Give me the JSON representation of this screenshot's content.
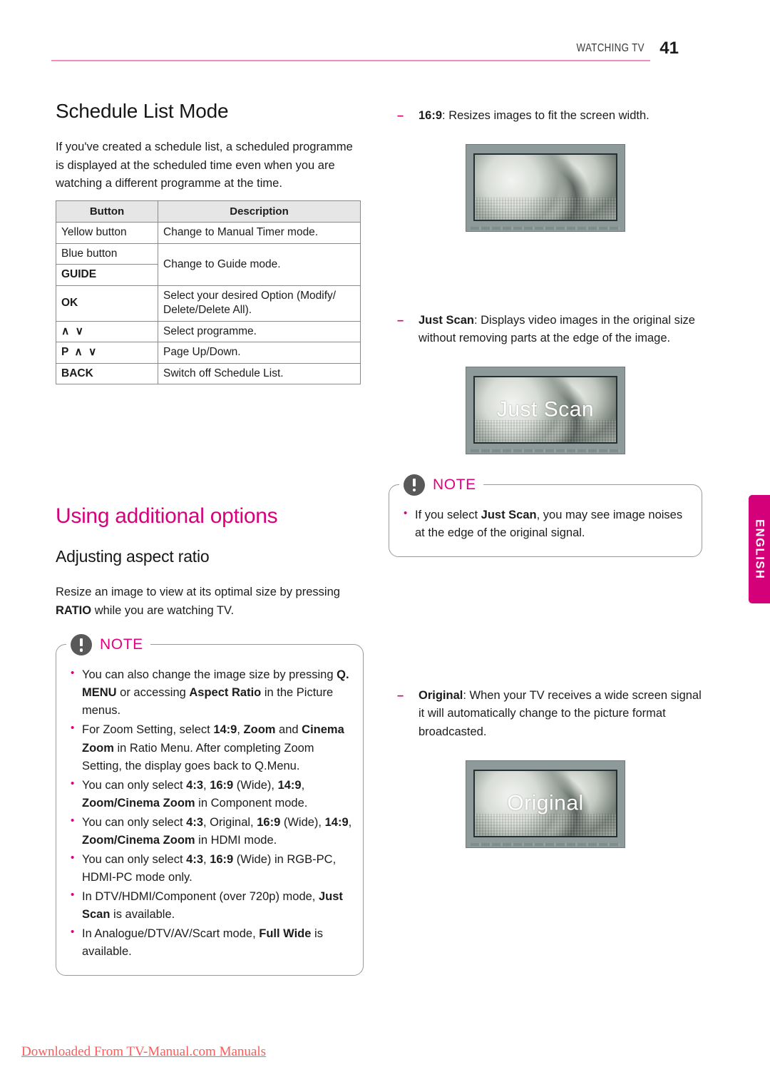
{
  "header": {
    "section_label": "WATCHING TV",
    "page_number": "41",
    "rule_color": "#f08cbe"
  },
  "left_column": {
    "title": "Schedule List Mode",
    "intro": "If you've created a schedule list, a scheduled programme is displayed at the scheduled time even when you are watching a different programme at the time.",
    "table": {
      "headers": [
        "Button",
        "Description"
      ],
      "rows": [
        {
          "button": "Yellow button",
          "bold": false,
          "description": "Change to Manual Timer mode."
        },
        {
          "button": "Blue button",
          "bold": false,
          "description": "Change to Guide mode.",
          "merged_start": true
        },
        {
          "button": "GUIDE",
          "bold": true,
          "description": ""
        },
        {
          "button": "OK",
          "bold": true,
          "description": "Select your desired Option (Modify/ Delete/Delete All)."
        },
        {
          "button": "∧ ∨",
          "bold": true,
          "description": "Select programme."
        },
        {
          "button": "P ∧ ∨",
          "bold": true,
          "description": "Page Up/Down."
        },
        {
          "button": "BACK",
          "bold": true,
          "description": "Switch off Schedule List."
        }
      ]
    },
    "section_title": "Using additional options",
    "sub_title": "Adjusting aspect ratio",
    "sub_intro_part1": "Resize an image to view at its optimal size by pressing ",
    "sub_intro_bold": "RATIO",
    "sub_intro_part2": " while you are watching TV.",
    "note": {
      "label": "NOTE",
      "icon": "exclamation-circle-icon",
      "items": [
        "You can also change the image size by pressing <b>Q. MENU</b> or accessing <b>Aspect Ratio</b> in the Picture menus.",
        "For Zoom Setting, select <b>14:9</b>, <b>Zoom</b> and <b>Cinema Zoom</b> in Ratio Menu. After completing Zoom Setting, the display goes back to Q.Menu.",
        "You can only select <b>4:3</b>, <b>16:9</b> (Wide), <b>14:9</b>, <b>Zoom/Cinema Zoom</b> in Component mode.",
        "You can only select <b>4:3</b>, Original, <b>16:9</b> (Wide), <b>14:9</b>, <b>Zoom/Cinema Zoom</b> in HDMI mode.",
        "You can only select <b>4:3</b>, <b>16:9</b> (Wide) in RGB-PC, HDMI-PC mode only.",
        "In DTV/HDMI/Component (over 720p) mode, <b>Just Scan</b> is available.",
        "In Analogue/DTV/AV/Scart mode, <b>Full Wide</b> is available."
      ]
    }
  },
  "right_column": {
    "item_169": "<b>16:9</b>: Resizes images to fit the screen width.",
    "tv_169_caption": "",
    "item_just_scan": "<b>Just Scan</b>: Displays video images in the original size without removing parts at the edge of the image.",
    "tv_just_scan_caption": "Just Scan",
    "note": {
      "label": "NOTE",
      "icon": "exclamation-circle-icon",
      "items": [
        "If you select <b>Just Scan</b>, you may see image noises at the edge of the original signal."
      ]
    },
    "item_original": "<b>Original</b>: When your TV receives a wide screen signal it will automatically change to the picture format  broadcasted.",
    "tv_original_caption": "Original"
  },
  "language_tab": {
    "label": "ENGLISH",
    "color": "#d4007a"
  },
  "footer": {
    "text": "Downloaded From TV-Manual.com Manuals",
    "color": "#ff5a5a"
  }
}
